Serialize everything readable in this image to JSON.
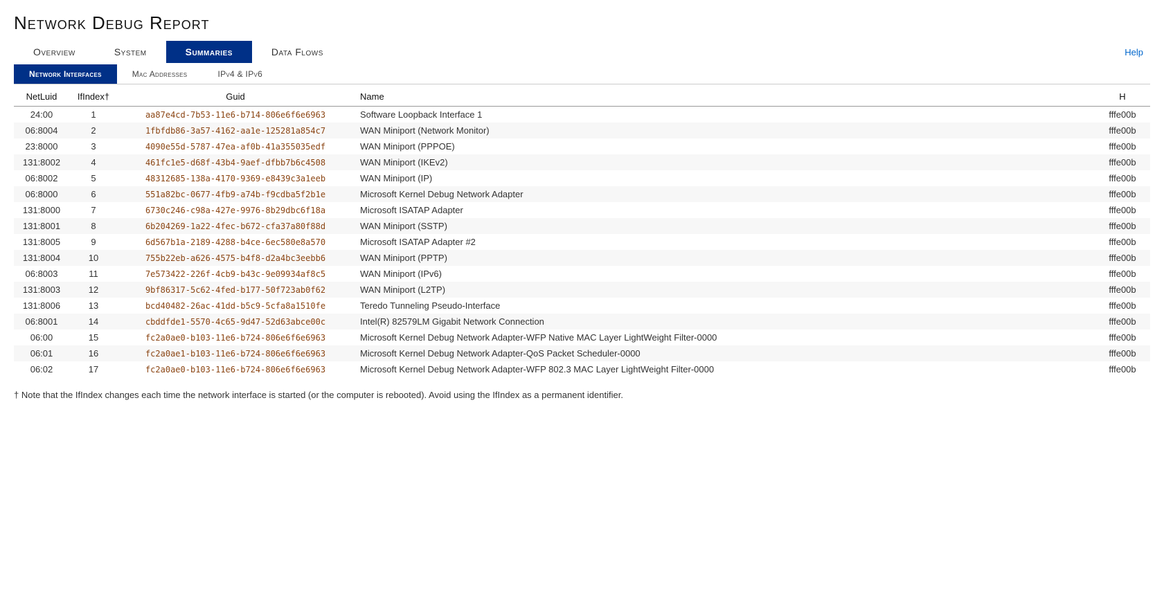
{
  "page": {
    "title": "Network Debug Report",
    "help_label": "Help"
  },
  "main_tabs": [
    {
      "id": "overview",
      "label": "Overview",
      "active": false
    },
    {
      "id": "system",
      "label": "System",
      "active": false
    },
    {
      "id": "summaries",
      "label": "Summaries",
      "active": true
    },
    {
      "id": "dataflows",
      "label": "Data Flows",
      "active": false
    }
  ],
  "sub_tabs": [
    {
      "id": "network-interfaces",
      "label": "Network Interfaces",
      "active": true
    },
    {
      "id": "mac-addresses",
      "label": "Mac Addresses",
      "active": false
    },
    {
      "id": "ipv4-ipv6",
      "label": "IPv4 & IPv6",
      "active": false
    }
  ],
  "table": {
    "columns": [
      {
        "id": "netluid",
        "label": "NetLuid"
      },
      {
        "id": "ifindex",
        "label": "IfIndex†"
      },
      {
        "id": "guid",
        "label": "Guid"
      },
      {
        "id": "name",
        "label": "Name"
      },
      {
        "id": "h",
        "label": "H"
      }
    ],
    "rows": [
      {
        "netluid": "24:00",
        "ifindex": "1",
        "guid": "aa87e4cd-7b53-11e6-b714-806e6f6e6963",
        "name": "Software Loopback Interface 1",
        "h": "fffe00b"
      },
      {
        "netluid": "06:8004",
        "ifindex": "2",
        "guid": "1fbfdb86-3a57-4162-aa1e-125281a854c7",
        "name": "WAN Miniport (Network Monitor)",
        "h": "fffe00b"
      },
      {
        "netluid": "23:8000",
        "ifindex": "3",
        "guid": "4090e55d-5787-47ea-af0b-41a355035edf",
        "name": "WAN Miniport (PPPOE)",
        "h": "fffe00b"
      },
      {
        "netluid": "131:8002",
        "ifindex": "4",
        "guid": "461fc1e5-d68f-43b4-9aef-dfbb7b6c4508",
        "name": "WAN Miniport (IKEv2)",
        "h": "fffe00b"
      },
      {
        "netluid": "06:8002",
        "ifindex": "5",
        "guid": "48312685-138a-4170-9369-e8439c3a1eeb",
        "name": "WAN Miniport (IP)",
        "h": "fffe00b"
      },
      {
        "netluid": "06:8000",
        "ifindex": "6",
        "guid": "551a82bc-0677-4fb9-a74b-f9cdba5f2b1e",
        "name": "Microsoft Kernel Debug Network Adapter",
        "h": "fffe00b"
      },
      {
        "netluid": "131:8000",
        "ifindex": "7",
        "guid": "6730c246-c98a-427e-9976-8b29dbc6f18a",
        "name": "Microsoft ISATAP Adapter",
        "h": "fffe00b"
      },
      {
        "netluid": "131:8001",
        "ifindex": "8",
        "guid": "6b204269-1a22-4fec-b672-cfa37a80f88d",
        "name": "WAN Miniport (SSTP)",
        "h": "fffe00b"
      },
      {
        "netluid": "131:8005",
        "ifindex": "9",
        "guid": "6d567b1a-2189-4288-b4ce-6ec580e8a570",
        "name": "Microsoft ISATAP Adapter #2",
        "h": "fffe00b"
      },
      {
        "netluid": "131:8004",
        "ifindex": "10",
        "guid": "755b22eb-a626-4575-b4f8-d2a4bc3eebb6",
        "name": "WAN Miniport (PPTP)",
        "h": "fffe00b"
      },
      {
        "netluid": "06:8003",
        "ifindex": "11",
        "guid": "7e573422-226f-4cb9-b43c-9e09934af8c5",
        "name": "WAN Miniport (IPv6)",
        "h": "fffe00b"
      },
      {
        "netluid": "131:8003",
        "ifindex": "12",
        "guid": "9bf86317-5c62-4fed-b177-50f723ab0f62",
        "name": "WAN Miniport (L2TP)",
        "h": "fffe00b"
      },
      {
        "netluid": "131:8006",
        "ifindex": "13",
        "guid": "bcd40482-26ac-41dd-b5c9-5cfa8a1510fe",
        "name": "Teredo Tunneling Pseudo-Interface",
        "h": "fffe00b"
      },
      {
        "netluid": "06:8001",
        "ifindex": "14",
        "guid": "cbddfde1-5570-4c65-9d47-52d63abce00c",
        "name": "Intel(R) 82579LM Gigabit Network Connection",
        "h": "fffe00b"
      },
      {
        "netluid": "06:00",
        "ifindex": "15",
        "guid": "fc2a0ae0-b103-11e6-b724-806e6f6e6963",
        "name": "Microsoft Kernel Debug Network Adapter-WFP Native MAC Layer LightWeight Filter-0000",
        "h": "fffe00b"
      },
      {
        "netluid": "06:01",
        "ifindex": "16",
        "guid": "fc2a0ae1-b103-11e6-b724-806e6f6e6963",
        "name": "Microsoft Kernel Debug Network Adapter-QoS Packet Scheduler-0000",
        "h": "fffe00b"
      },
      {
        "netluid": "06:02",
        "ifindex": "17",
        "guid": "fc2a0ae0-b103-11e6-b724-806e6f6e6963",
        "name": "Microsoft Kernel Debug Network Adapter-WFP 802.3 MAC Layer LightWeight Filter-0000",
        "h": "fffe00b"
      }
    ]
  },
  "footnote": "† Note that the IfIndex changes each time the network interface is started (or the computer is rebooted). Avoid using the IfIndex as a permanent identifier."
}
